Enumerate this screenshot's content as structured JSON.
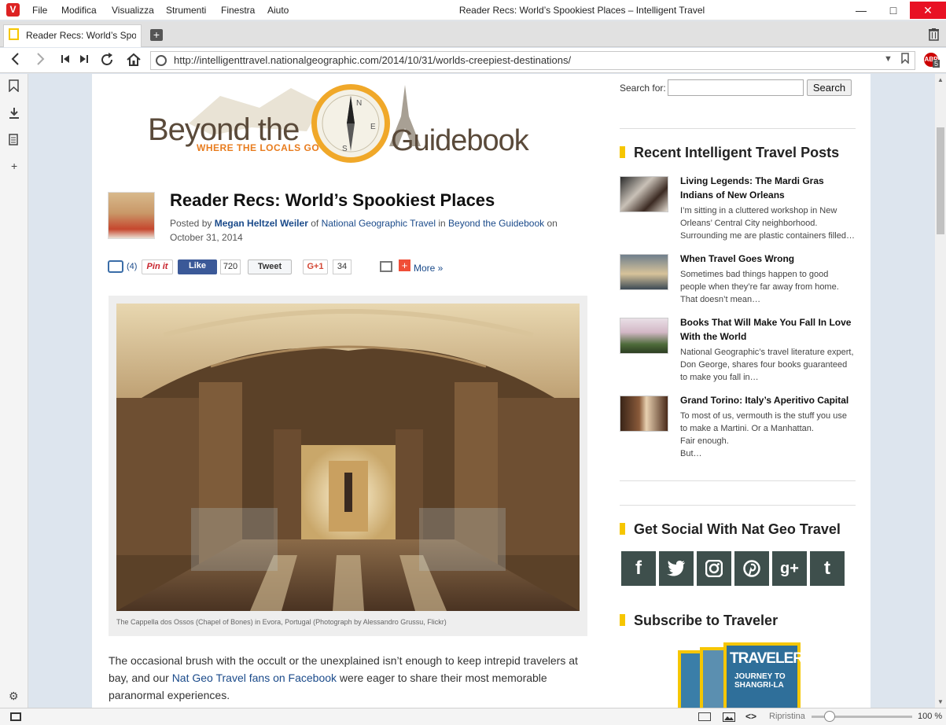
{
  "window": {
    "title": "Reader Recs: World’s Spookiest Places – Intelligent Travel",
    "menu": [
      "File",
      "Modifica",
      "Visualizza",
      "Strumenti",
      "Finestra",
      "Aiuto"
    ]
  },
  "tab": {
    "label": "Reader Recs: World’s Spookiest Places"
  },
  "address": {
    "url": "http://intelligenttravel.nationalgeographic.com/2014/10/31/worlds-creepiest-destinations/",
    "abp_count": "5",
    "abp_label": "ABP"
  },
  "logo": {
    "line1": "Beyond the",
    "line2": "WHERE THE LOCALS GO",
    "line3": "Guidebook"
  },
  "article": {
    "title": "Reader Recs: World’s Spookiest Places",
    "byline_prefix": "Posted by",
    "author": "Megan Heltzel Weiler",
    "byline_of": "of",
    "publisher": "National Geographic Travel",
    "byline_in": "in",
    "blog": "Beyond the Guidebook",
    "byline_on": "on",
    "date": "October 31, 2014",
    "share": {
      "comments": "(4)",
      "pin": "Pin it",
      "fb_like": "Like",
      "fb_count": "720",
      "tweet": "Tweet",
      "gplus": "G+1",
      "gplus_count": "34",
      "more": "More »"
    },
    "caption": "The Cappella dos Ossos (Chapel of Bones) in Evora, Portugal (Photograph by Alessandro Grussu, Flickr)",
    "para_1": "The occasional brush with the occult or the unexplained isn’t enough to keep intrepid travelers at bay, and our ",
    "para_link": "Nat Geo Travel fans on Facebook",
    "para_2": " were eager to share their most memorable paranormal experiences."
  },
  "sidebar": {
    "search_label": "Search for:",
    "search_button": "Search",
    "recent_heading": "Recent Intelligent Travel Posts",
    "posts": [
      {
        "title": "Living Legends: The Mardi Gras Indians of New Orleans",
        "excerpt": "I’m sitting in a cluttered workshop in New Orleans’ Central City neighborhood. Surrounding me are plastic containers filled…"
      },
      {
        "title": "When Travel Goes Wrong",
        "excerpt": "Sometimes bad things happen to good people when they’re far away from home. That doesn’t mean…"
      },
      {
        "title": "Books That Will Make You Fall In Love With the World",
        "excerpt": "National Geographic’s travel literature expert, Don George, shares four books guaranteed to make you fall in…"
      },
      {
        "title": "Grand Torino: Italy’s Aperitivo Capital",
        "excerpt_lines": [
          "To most of us, vermouth is the stuff you use to make a Martini. Or a Manhattan.",
          "Fair enough.",
          "But…"
        ]
      }
    ],
    "social_heading": "Get Social With Nat Geo Travel",
    "social": [
      "f",
      "t",
      "ig",
      "p",
      "g+",
      "t"
    ],
    "subscribe_heading": "Subscribe to Traveler",
    "mag": {
      "title": "TRAVELER",
      "cover_line": "JOURNEY TO SHANGRI-LA"
    }
  },
  "status": {
    "zoom_label": "Ripristina",
    "zoom": "100 %"
  },
  "colors": {
    "accent": "#f6c600",
    "link": "#1a4a8a",
    "social": "#3e4f4c",
    "close": "#e81123"
  }
}
